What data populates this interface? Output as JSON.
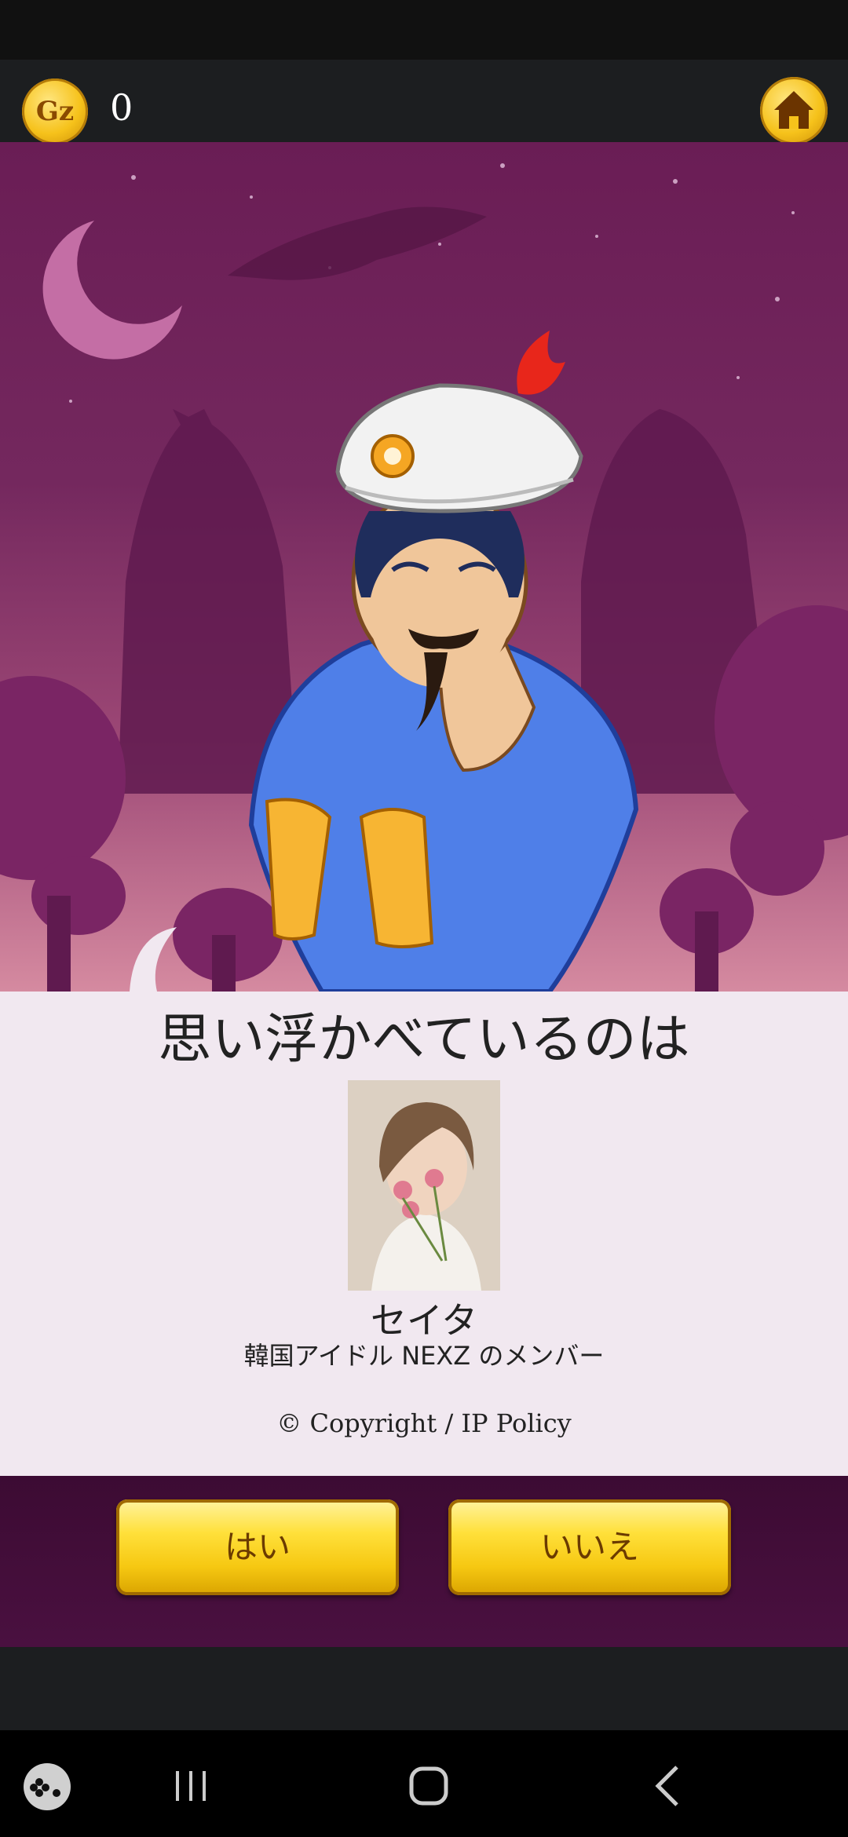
{
  "topbar": {
    "coin_symbol": "Gz",
    "coin_count": "0"
  },
  "panel": {
    "question": "思い浮かべているのは",
    "character_name": "セイタ",
    "character_description": "韓国アイドル NEXZ のメンバー",
    "copyright": "© Copyright / IP Policy"
  },
  "buttons": {
    "yes_label": "はい",
    "no_label": "いいえ"
  },
  "colors": {
    "gold": "#f6c21b",
    "scene_purple": "#6a1d55",
    "turban_white": "#f2f2f2",
    "shirt_blue": "#4f7fe8"
  },
  "icons": [
    "coin-icon",
    "home-icon",
    "game-launcher-icon",
    "recent-apps-icon",
    "home-nav-icon",
    "back-icon"
  ]
}
